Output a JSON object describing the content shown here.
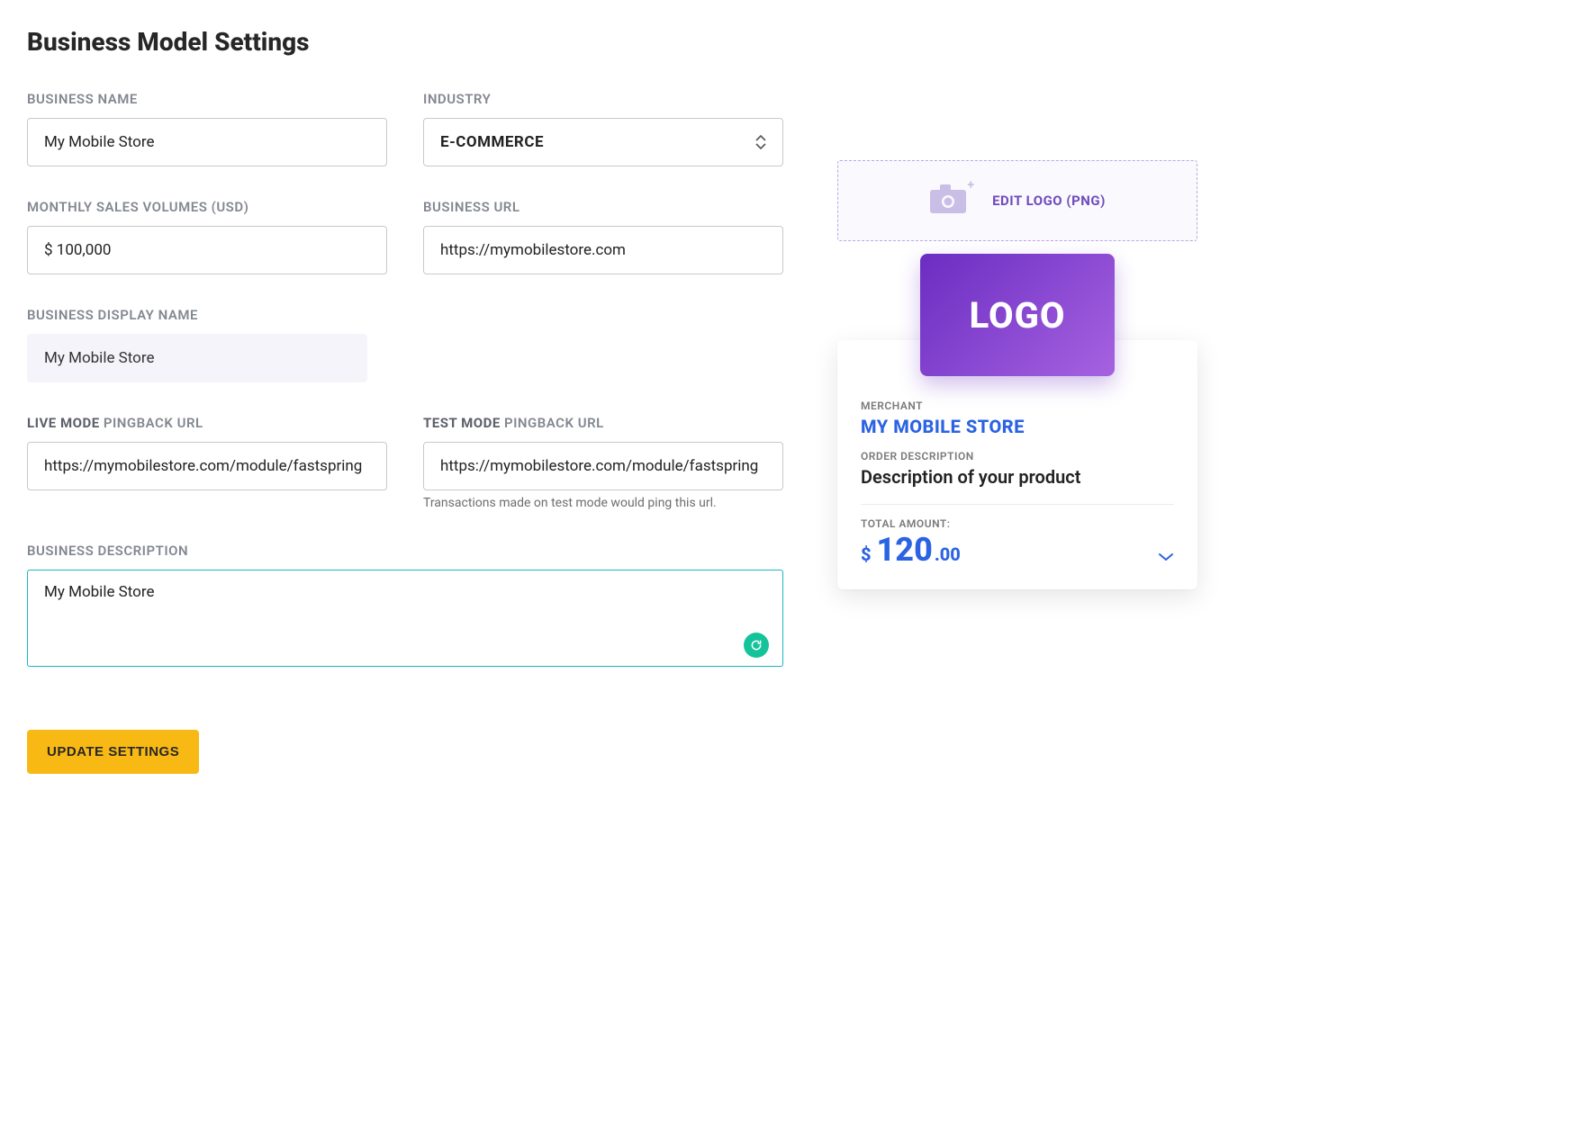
{
  "page": {
    "title": "Business Model Settings"
  },
  "labels": {
    "business_name": "BUSINESS NAME",
    "industry": "INDUSTRY",
    "monthly_sales": "MONTHLY SALES VOLUMES (USD)",
    "business_url": "BUSINESS URL",
    "display_name": "BUSINESS DISPLAY NAME",
    "live_mode_strong": "LIVE MODE",
    "live_mode_rest": " PINGBACK URL",
    "test_mode_strong": "TEST MODE",
    "test_mode_rest": " PINGBACK URL",
    "test_helper": "Transactions made on test mode would ping this url.",
    "description": "BUSINESS DESCRIPTION",
    "submit": "UPDATE SETTINGS",
    "edit_logo": "EDIT LOGO (PNG)"
  },
  "values": {
    "business_name": "My Mobile Store",
    "industry": "E-COMMERCE",
    "monthly_sales": "$ 100,000",
    "business_url": "https://mymobilestore.com",
    "display_name": "My Mobile Store",
    "live_pingback": "https://mymobilestore.com/module/fastspring",
    "test_pingback": "https://mymobilestore.com/module/fastspring",
    "description": "My Mobile Store"
  },
  "preview": {
    "logo_text": "LOGO",
    "merchant_label": "MERCHANT",
    "merchant_name": "MY MOBILE STORE",
    "order_label": "ORDER DESCRIPTION",
    "order_desc": "Description of your product",
    "total_label": "TOTAL AMOUNT:",
    "currency": "$",
    "amount_major": "120",
    "amount_minor": ".00"
  }
}
